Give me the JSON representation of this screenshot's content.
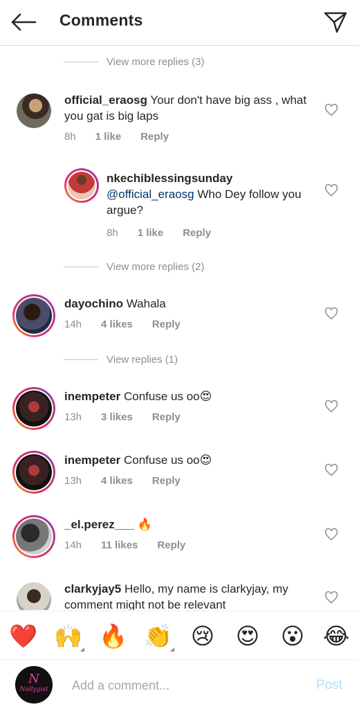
{
  "header": {
    "title": "Comments",
    "back_icon": "arrow-left-icon",
    "send_icon": "paper-plane-icon"
  },
  "comments": [
    {
      "type": "view_more",
      "label": "View more replies (3)"
    },
    {
      "type": "comment",
      "username": "official_eraosg",
      "text": "Your don't have big ass , what you gat is big laps",
      "time": "8h",
      "likes": "1 like",
      "reply": "Reply"
    },
    {
      "type": "reply",
      "username": "nkechiblessingsunday",
      "mention": "@official_eraosg",
      "text": "Who Dey follow you argue?",
      "time": "8h",
      "likes": "1 like",
      "reply": "Reply"
    },
    {
      "type": "view_more",
      "label": "View more replies (2)"
    },
    {
      "type": "comment",
      "username": "dayochino",
      "text": "Wahala",
      "time": "14h",
      "likes": "4 likes",
      "reply": "Reply"
    },
    {
      "type": "view_more",
      "label": "View replies (1)"
    },
    {
      "type": "comment",
      "username": "inempeter",
      "text": "Confuse us oo😍",
      "time": "13h",
      "likes": "3 likes",
      "reply": "Reply"
    },
    {
      "type": "comment",
      "username": "inempeter",
      "text": "Confuse us oo😍",
      "time": "13h",
      "likes": "4 likes",
      "reply": "Reply"
    },
    {
      "type": "comment",
      "username": "_el.perez___",
      "text": "🔥",
      "time": "14h",
      "likes": "11 likes",
      "reply": "Reply"
    },
    {
      "type": "comment",
      "username": "clarkyjay5",
      "text": "Hello, my name is clarkyjay, my comment might not be relevant"
    }
  ],
  "emoji_bar": [
    "❤️",
    "🙌",
    "🔥",
    "👏",
    "😢",
    "😍",
    "😮",
    "😂"
  ],
  "composer": {
    "placeholder": "Add a comment...",
    "post_label": "Post",
    "avatar_text": "Nollygist"
  },
  "colors": {
    "accent_blue_disabled": "#b2dffc",
    "mention_blue": "#003569",
    "muted_gray": "#8e8e8e",
    "story_ring": "#e1306c"
  }
}
